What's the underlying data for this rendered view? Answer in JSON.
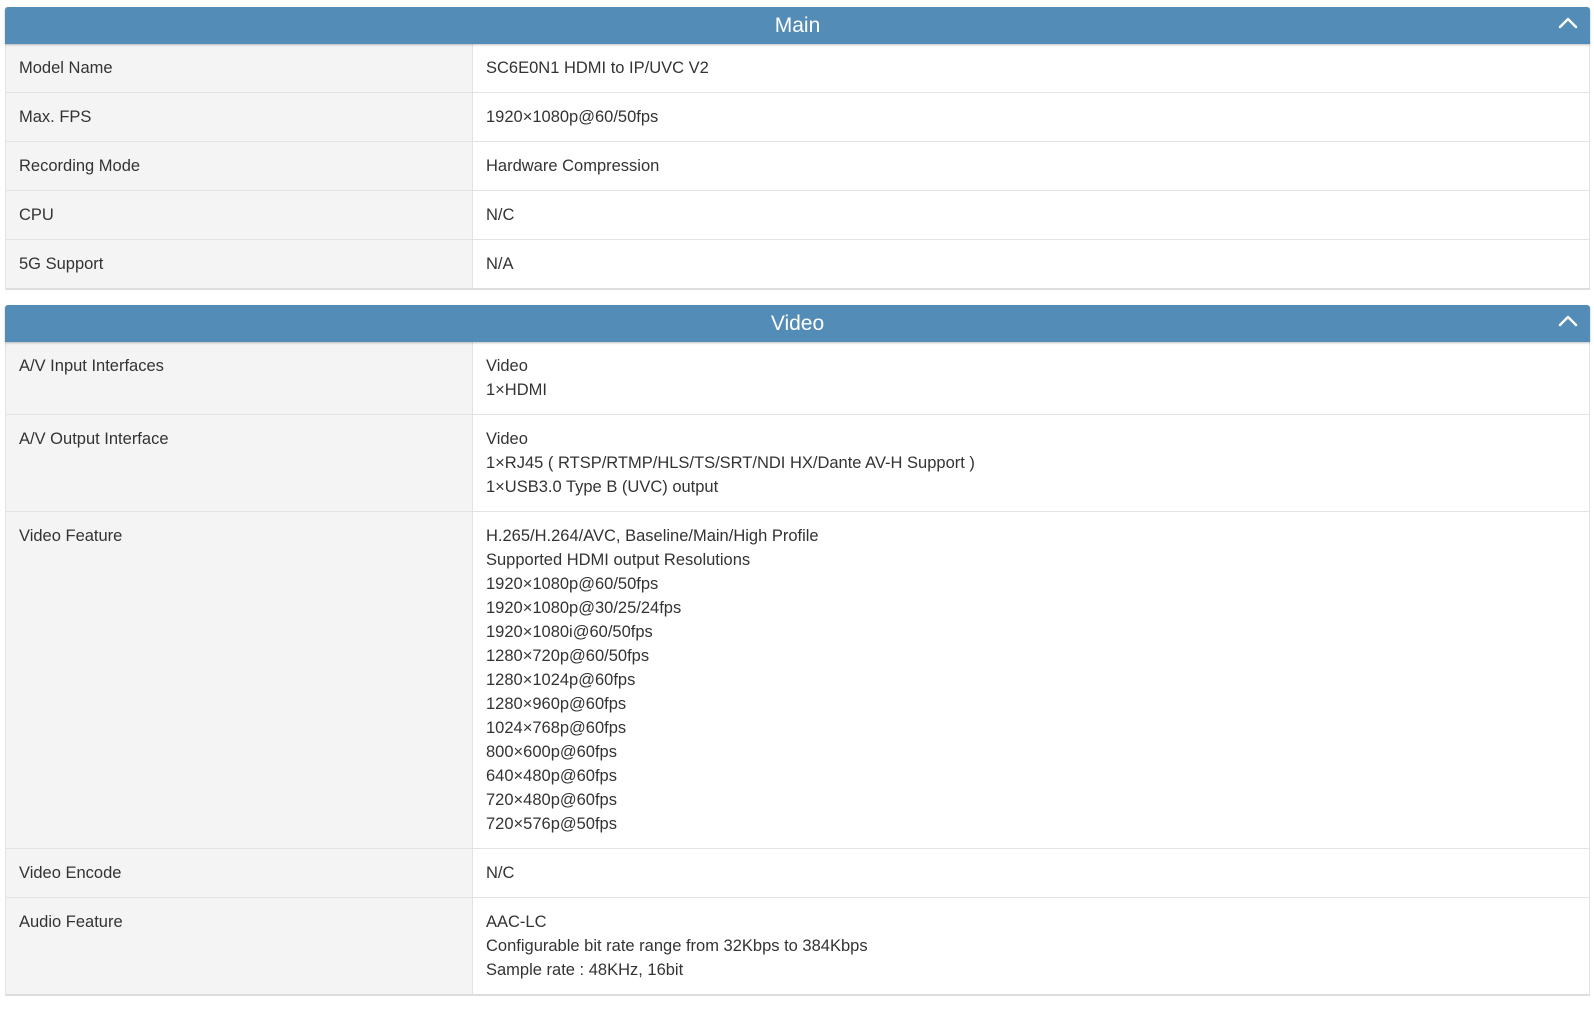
{
  "sections": [
    {
      "title": "Main",
      "rows": [
        {
          "label": "Model Name",
          "values": [
            "SC6E0N1 HDMI to IP/UVC V2"
          ]
        },
        {
          "label": "Max. FPS",
          "values": [
            "1920×1080p@60/50fps"
          ]
        },
        {
          "label": "Recording Mode",
          "values": [
            "Hardware Compression"
          ]
        },
        {
          "label": "CPU",
          "values": [
            "N/C"
          ]
        },
        {
          "label": "5G Support",
          "values": [
            "N/A"
          ]
        }
      ]
    },
    {
      "title": "Video",
      "rows": [
        {
          "label": "A/V Input Interfaces",
          "values": [
            "Video",
            "1×HDMI"
          ]
        },
        {
          "label": "A/V Output Interface",
          "values": [
            "Video",
            "1×RJ45 ( RTSP/RTMP/HLS/TS/SRT/NDI HX/Dante AV-H Support )",
            "1×USB3.0 Type B (UVC) output"
          ]
        },
        {
          "label": "Video Feature",
          "values": [
            "H.265/H.264/AVC, Baseline/Main/High Profile",
            "Supported HDMI output Resolutions",
            "1920×1080p@60/50fps",
            "1920×1080p@30/25/24fps",
            "1920×1080i@60/50fps",
            "1280×720p@60/50fps",
            "1280×1024p@60fps",
            "1280×960p@60fps",
            "1024×768p@60fps",
            "800×600p@60fps",
            "640×480p@60fps",
            "720×480p@60fps",
            "720×576p@50fps"
          ]
        },
        {
          "label": "Video Encode",
          "values": [
            "N/C"
          ]
        },
        {
          "label": "Audio Feature",
          "values": [
            "AAC-LC",
            "Configurable bit rate range from 32Kbps to 384Kbps",
            "Sample rate : 48KHz, 16bit"
          ]
        }
      ]
    }
  ],
  "icons": {
    "toggle": "chevron-up-icon"
  },
  "colors": {
    "header": "#548cb8",
    "label_bg": "#f4f4f4"
  }
}
